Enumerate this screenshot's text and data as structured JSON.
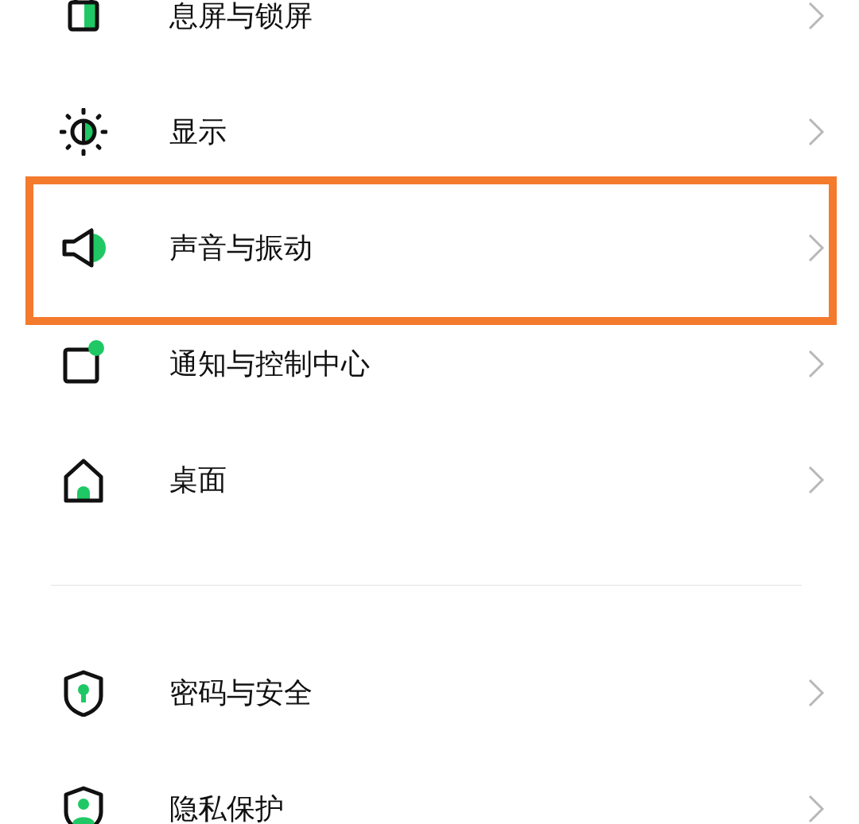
{
  "sections": [
    {
      "items": [
        {
          "label": "息屏与锁屏",
          "selected": false
        },
        {
          "label": "显示",
          "selected": false
        },
        {
          "label": "声音与振动",
          "selected": true
        },
        {
          "label": "通知与控制中心",
          "selected": false
        },
        {
          "label": "桌面",
          "selected": false
        }
      ]
    },
    {
      "items": [
        {
          "label": "密码与安全",
          "selected": false
        },
        {
          "label": "隐私保护",
          "selected": false
        }
      ]
    }
  ]
}
